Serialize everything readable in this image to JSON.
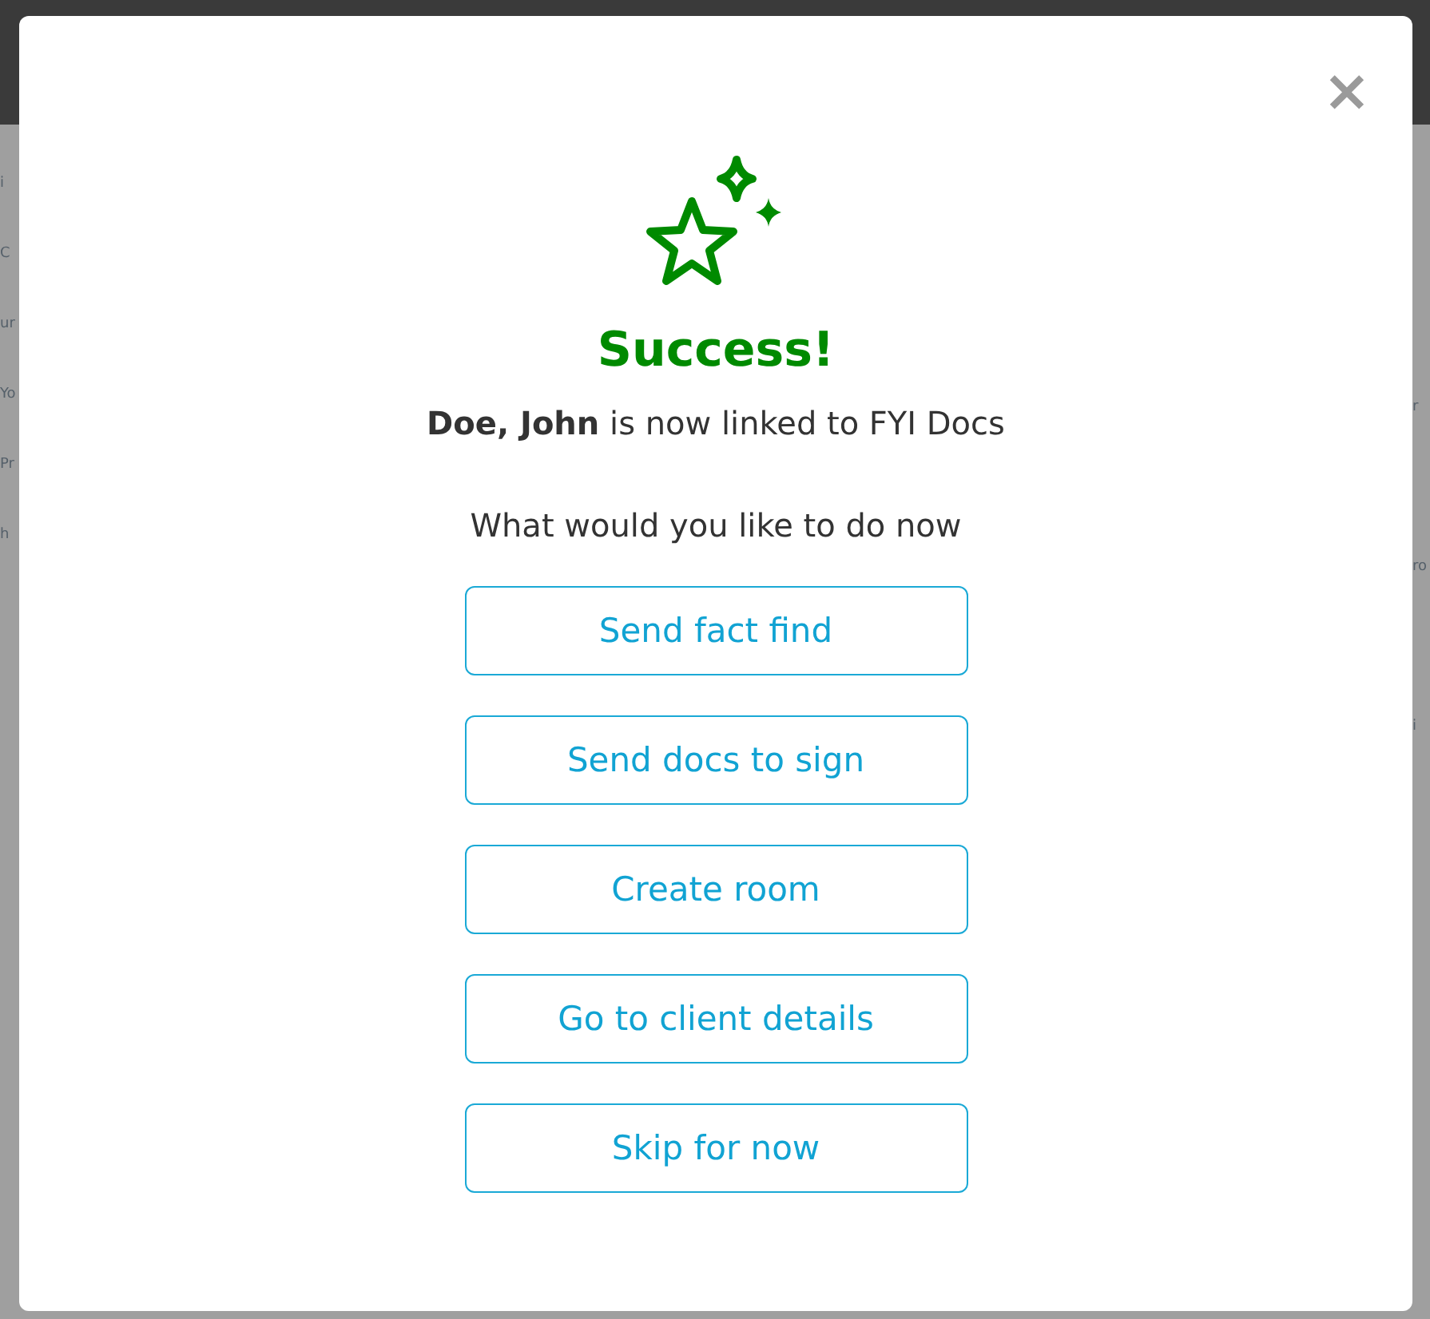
{
  "backdrop": {
    "left_fragments": [
      "i",
      "C",
      "ur",
      "Yo",
      "Pr",
      "h"
    ],
    "right_fragments": [
      "r",
      "ro",
      "i"
    ]
  },
  "dialog": {
    "close": "×",
    "title": "Success!",
    "message": "**Doe, John** is now linked to FYI Docs",
    "prompt": "What would you like to do now",
    "actions": [
      "Send fact find",
      "Send docs to sign",
      "Create room",
      "Go to client details",
      "Skip for now"
    ]
  }
}
